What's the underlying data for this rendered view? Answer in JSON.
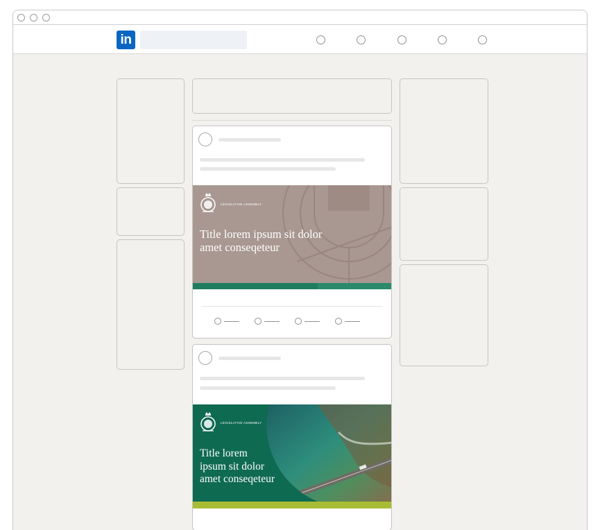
{
  "window": {
    "traffic_lights": [
      "close",
      "minimize",
      "zoom"
    ]
  },
  "navbar": {
    "logo_text": "in",
    "search": {
      "placeholder": "",
      "value": ""
    },
    "icons": [
      "nav-home-icon",
      "nav-network-icon",
      "nav-jobs-icon",
      "nav-messaging-icon",
      "nav-notifications-icon"
    ]
  },
  "feed": {
    "posts": [
      {
        "banner": {
          "org": "LEGISLATIVE ASSEMBLY",
          "title": "Title lorem ipsum sit dolor\namet conseqeteur",
          "background": "#a89891",
          "accent": "#1f7d5f",
          "accent_secondary": "#12604a"
        },
        "actions": [
          "like-action",
          "comment-action",
          "share-action",
          "send-action"
        ]
      },
      {
        "banner": {
          "org": "LEGISLATIVE ASSEMBLY",
          "title": "Title lorem\nipsum sit dolor\namet conseqeteur",
          "background": "#0f6a52",
          "accent": "#a8bd33"
        }
      }
    ]
  },
  "colors": {
    "page_background": "#f2f1ee",
    "linkedin_blue": "#0a66c2",
    "skeleton": "#e7e7e7"
  }
}
